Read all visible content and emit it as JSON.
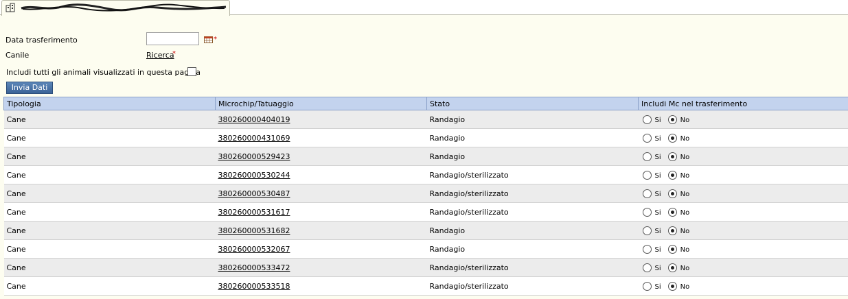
{
  "tab": {
    "icon": "building-icon"
  },
  "form": {
    "data_trasferimento_label": "Data trasferimento",
    "data_trasferimento_value": "",
    "required_mark": "*",
    "canile_label": "Canile",
    "ricerca_link": "Ricerca",
    "includi_tutti_label": "Includi tutti gli animali visualizzati in questa pagina",
    "invia_button": "Invia Dati"
  },
  "table": {
    "headers": [
      "Tipologia",
      "Microchip/Tatuaggio",
      "Stato",
      "Includi Mc nel trasferimento"
    ],
    "radio_si": "Si",
    "radio_no": "No",
    "rows": [
      {
        "tipologia": "Cane",
        "microchip": "380260000404019",
        "stato": "Randagio"
      },
      {
        "tipologia": "Cane",
        "microchip": "380260000431069",
        "stato": "Randagio"
      },
      {
        "tipologia": "Cane",
        "microchip": "380260000529423",
        "stato": "Randagio"
      },
      {
        "tipologia": "Cane",
        "microchip": "380260000530244",
        "stato": "Randagio/sterilizzato"
      },
      {
        "tipologia": "Cane",
        "microchip": "380260000530487",
        "stato": "Randagio/sterilizzato"
      },
      {
        "tipologia": "Cane",
        "microchip": "380260000531617",
        "stato": "Randagio/sterilizzato"
      },
      {
        "tipologia": "Cane",
        "microchip": "380260000531682",
        "stato": "Randagio"
      },
      {
        "tipologia": "Cane",
        "microchip": "380260000532067",
        "stato": "Randagio"
      },
      {
        "tipologia": "Cane",
        "microchip": "380260000533472",
        "stato": "Randagio/sterilizzato"
      },
      {
        "tipologia": "Cane",
        "microchip": "380260000533518",
        "stato": "Randagio/sterilizzato"
      }
    ]
  }
}
